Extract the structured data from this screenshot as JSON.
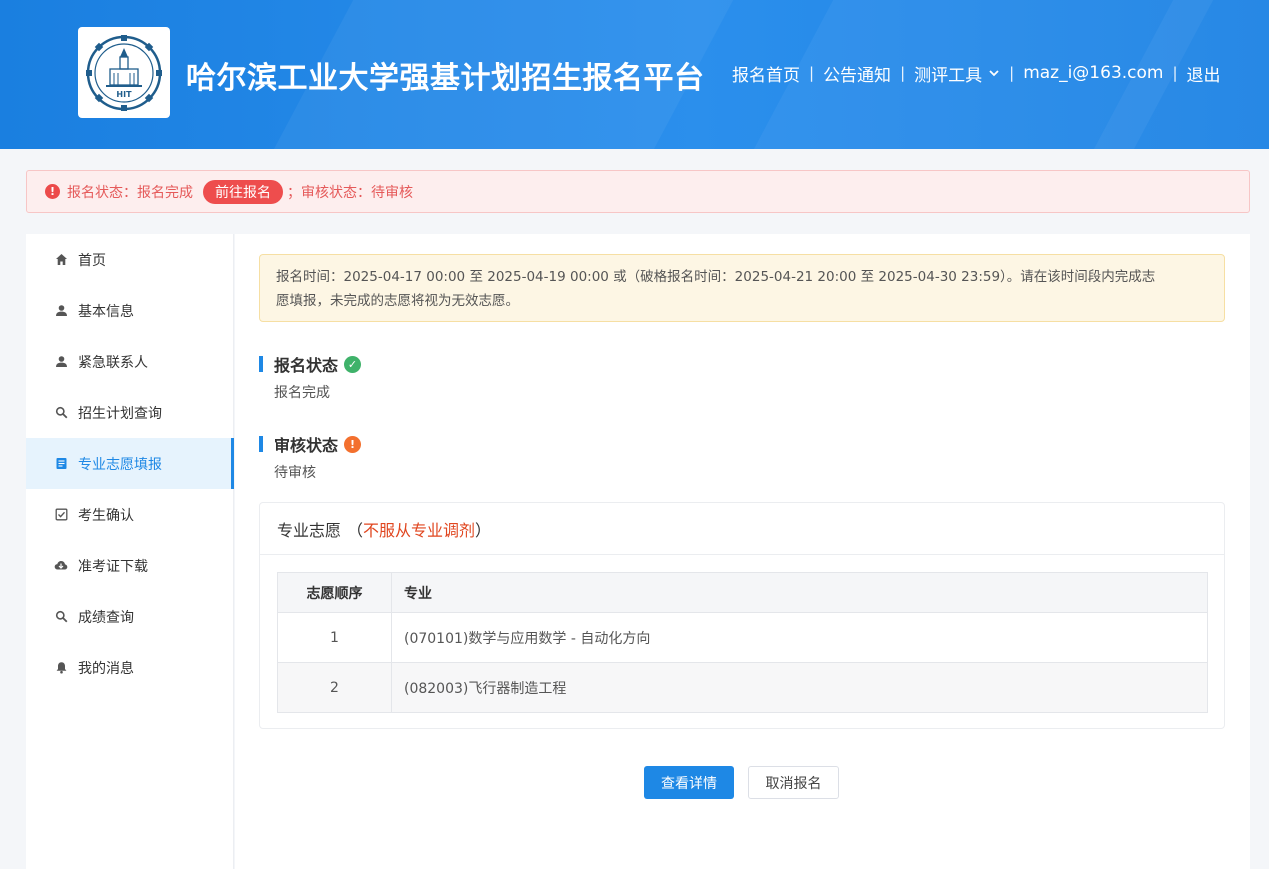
{
  "header": {
    "title": "哈尔滨工业大学强基计划招生报名平台",
    "logo_text": "HIT",
    "nav": [
      {
        "label": "报名首页"
      },
      {
        "label": "公告通知"
      },
      {
        "label": "测评工具",
        "has_dropdown": true
      },
      {
        "label": "maz_i@163.com"
      },
      {
        "label": "退出"
      }
    ]
  },
  "alert": {
    "text_before": "报名状态：报名完成",
    "pill": "前往报名",
    "text_after": "；审核状态：待审核"
  },
  "sidebar": {
    "items": [
      {
        "label": "首页",
        "icon": "home-icon"
      },
      {
        "label": "基本信息",
        "icon": "user-icon"
      },
      {
        "label": "紧急联系人",
        "icon": "user-icon"
      },
      {
        "label": "招生计划查询",
        "icon": "search-icon"
      },
      {
        "label": "专业志愿填报",
        "icon": "document-icon",
        "active": true
      },
      {
        "label": "考生确认",
        "icon": "checkbox-icon"
      },
      {
        "label": "准考证下载",
        "icon": "cloud-download-icon"
      },
      {
        "label": "成绩查询",
        "icon": "search-icon"
      },
      {
        "label": "我的消息",
        "icon": "bell-icon"
      }
    ]
  },
  "main": {
    "notice_line1": "报名时间：2025-04-17 00:00 至 2025-04-19 00:00 或（破格报名时间：2025-04-21 20:00 至 2025-04-30 23:59）。请在该时间段内完成志",
    "notice_line2": "愿填报，未完成的志愿将视为无效志愿。",
    "reg_status": {
      "title": "报名状态",
      "value": "报名完成",
      "badge_color": "#3fb26a"
    },
    "review_status": {
      "title": "审核状态",
      "value": "待审核",
      "badge_color": "#f3702e"
    },
    "volunteer": {
      "title": "专业志愿",
      "paren_open": "（",
      "adjust": "不服从专业调剂",
      "paren_close": "）",
      "columns": [
        "志愿顺序",
        "专业"
      ],
      "rows": [
        {
          "order": "1",
          "major": "(070101)数学与应用数学 - 自动化方向"
        },
        {
          "order": "2",
          "major": "(082003)飞行器制造工程"
        }
      ]
    },
    "buttons": {
      "detail": "查看详情",
      "cancel": "取消报名"
    }
  }
}
